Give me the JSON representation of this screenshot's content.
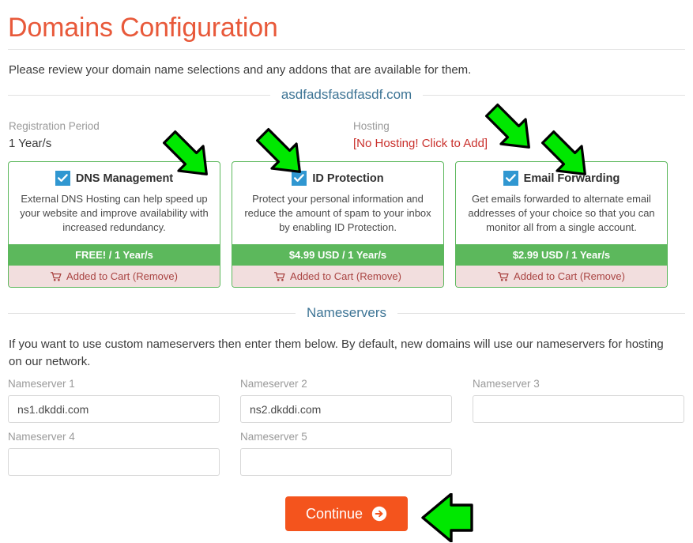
{
  "header": {
    "title": "Domains Configuration",
    "intro": "Please review your domain name selections and any addons that are available for them."
  },
  "domain": {
    "name": "asdfadsfasdfasdf.com"
  },
  "registration": {
    "label": "Registration Period",
    "value": "1 Year/s"
  },
  "hosting": {
    "label": "Hosting",
    "value": "[No Hosting! Click to Add]",
    "color": "#c9302c"
  },
  "addons": [
    {
      "name": "DNS Management",
      "description": "External DNS Hosting can help speed up your website and improve availability with increased redundancy.",
      "price": "FREE! / 1 Year/s",
      "cart": "Added to Cart (Remove)",
      "checked": true
    },
    {
      "name": "ID Protection",
      "description": "Protect your personal information and reduce the amount of spam to your inbox by enabling ID Protection.",
      "price": "$4.99 USD / 1 Year/s",
      "cart": "Added to Cart (Remove)",
      "checked": true
    },
    {
      "name": "Email Forwarding",
      "description": "Get emails forwarded to alternate email addresses of your choice so that you can monitor all from a single account.",
      "price": "$2.99 USD / 1 Year/s",
      "cart": "Added to Cart (Remove)",
      "checked": true
    }
  ],
  "nameservers": {
    "heading": "Nameservers",
    "intro": "If you want to use custom nameservers then enter them below. By default, new domains will use our nameservers for hosting on our network.",
    "fields": [
      {
        "label": "Nameserver 1",
        "value": "ns1.dkddi.com"
      },
      {
        "label": "Nameserver 2",
        "value": "ns2.dkddi.com"
      },
      {
        "label": "Nameserver 3",
        "value": ""
      },
      {
        "label": "Nameserver 4",
        "value": ""
      },
      {
        "label": "Nameserver 5",
        "value": ""
      }
    ]
  },
  "footer": {
    "continue_label": "Continue"
  },
  "colors": {
    "title": "#e8593a",
    "accent_green": "#5cb85c",
    "checkbox_blue": "#3097d1",
    "cart_pink": "#f2dede",
    "cart_text": "#a94442",
    "button_orange": "#f4541d",
    "annotation_arrow": "#00e800"
  }
}
